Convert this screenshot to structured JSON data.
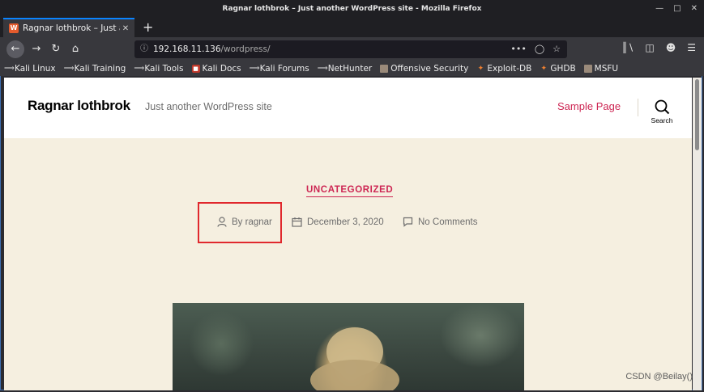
{
  "window": {
    "title": "Ragnar lothbrok – Just another WordPress site - Mozilla Firefox"
  },
  "tab": {
    "title": "Ragnar lothbrok – Just an",
    "favicon_letter": "W"
  },
  "urlbar": {
    "host": "192.168.11.136",
    "path": "/wordpress/"
  },
  "bookmarks": [
    {
      "label": "Kali Linux",
      "icon": "kali-dragon-icon"
    },
    {
      "label": "Kali Training",
      "icon": "kali-dragon-icon"
    },
    {
      "label": "Kali Tools",
      "icon": "kali-dragon-icon"
    },
    {
      "label": "Kali Docs",
      "icon": "kali-docs-icon"
    },
    {
      "label": "Kali Forums",
      "icon": "kali-dragon-icon"
    },
    {
      "label": "NetHunter",
      "icon": "nethunter-icon"
    },
    {
      "label": "Offensive Security",
      "icon": "offsec-icon"
    },
    {
      "label": "Exploit-DB",
      "icon": "exploitdb-icon"
    },
    {
      "label": "GHDB",
      "icon": "ghdb-icon"
    },
    {
      "label": "MSFU",
      "icon": "msfu-icon"
    }
  ],
  "site": {
    "title": "Ragnar lothbrok",
    "description": "Just another WordPress site",
    "menu": [
      "Sample Page"
    ],
    "search_label": "Search"
  },
  "post": {
    "category": "UNCATEGORIZED",
    "author": "By ragnar",
    "date": "December 3, 2020",
    "comments": "No Comments"
  },
  "colors": {
    "accent": "#cd2653",
    "page_bg": "#f5efe0",
    "highlight": "#e0282d"
  },
  "watermark": "CSDN @Beilay()"
}
